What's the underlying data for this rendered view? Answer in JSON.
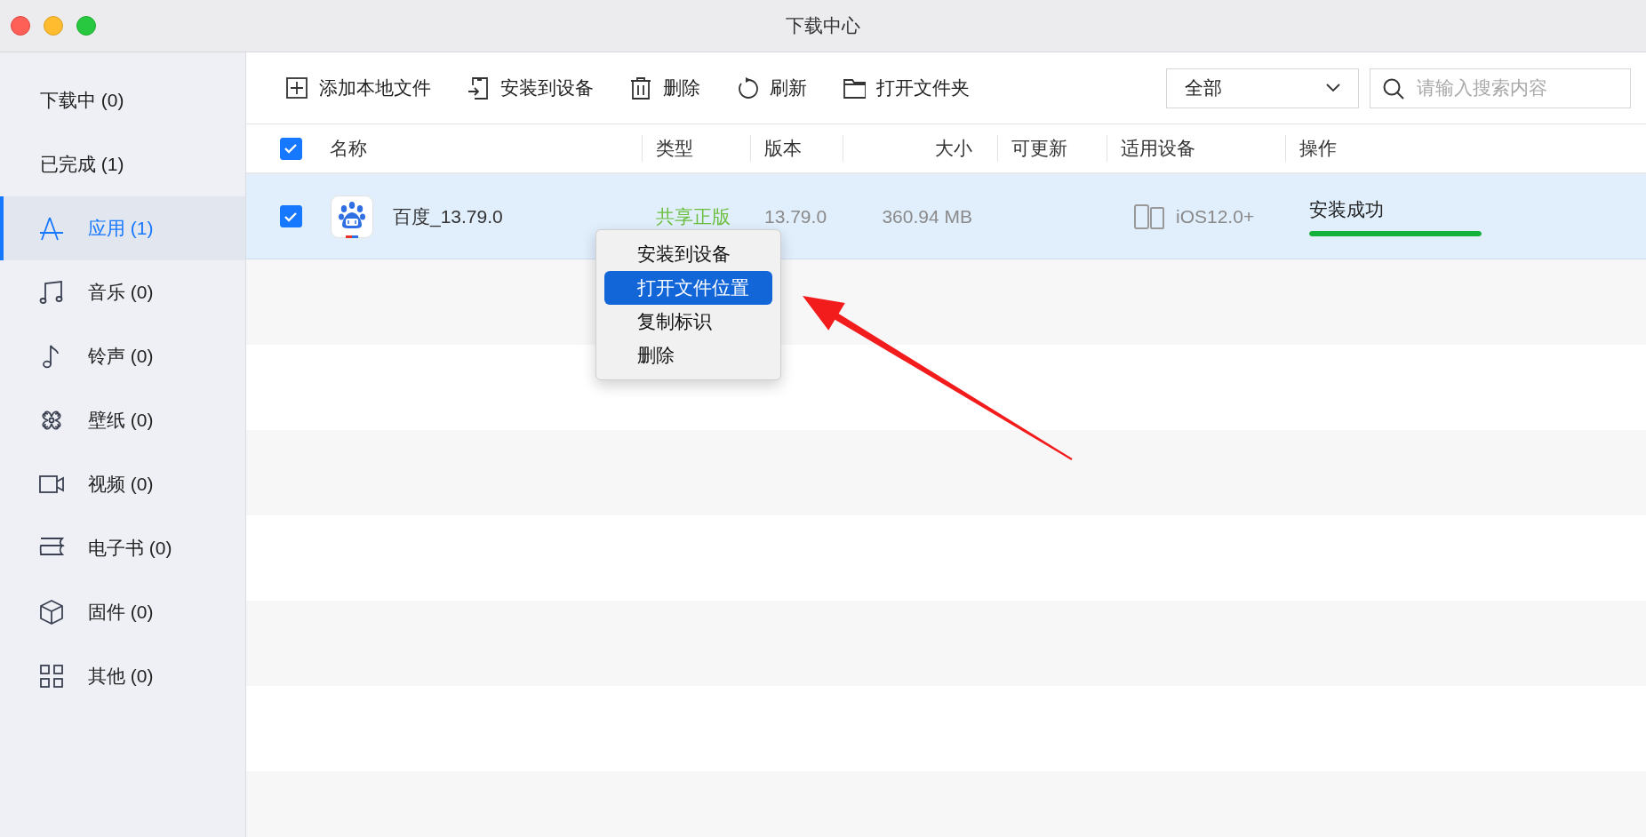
{
  "window": {
    "title": "下载中心"
  },
  "sidebar": {
    "items": [
      {
        "kind": "status",
        "label": "下载中 (0)",
        "selected": false
      },
      {
        "kind": "status",
        "label": "已完成 (1)",
        "selected": false
      },
      {
        "kind": "category",
        "label": "应用 (1)",
        "selected": true
      },
      {
        "kind": "category",
        "label": "音乐 (0)",
        "selected": false
      },
      {
        "kind": "category",
        "label": "铃声 (0)",
        "selected": false
      },
      {
        "kind": "category",
        "label": "壁纸 (0)",
        "selected": false
      },
      {
        "kind": "category",
        "label": "视频 (0)",
        "selected": false
      },
      {
        "kind": "category",
        "label": "电子书 (0)",
        "selected": false
      },
      {
        "kind": "category",
        "label": "固件 (0)",
        "selected": false
      },
      {
        "kind": "category",
        "label": "其他 (0)",
        "selected": false
      }
    ]
  },
  "toolbar": {
    "buttons": [
      "添加本地文件",
      "安装到设备",
      "删除",
      "刷新",
      "打开文件夹"
    ],
    "filter": {
      "value": "全部"
    },
    "search": {
      "placeholder": "请输入搜索内容"
    }
  },
  "table": {
    "select_all": {
      "checked": true
    },
    "columns": [
      "名称",
      "类型",
      "版本",
      "大小",
      "可更新",
      "适用设备",
      "操作"
    ],
    "rows": [
      {
        "selected": true,
        "checked": true,
        "name": "百度_13.79.0",
        "type": "共享正版",
        "version": "13.79.0",
        "size": "360.94 MB",
        "device": "iOS12.0+",
        "action": "安装成功",
        "level": 1
      }
    ]
  },
  "context_menu": {
    "items": [
      {
        "label": "安装到设备",
        "selected": false
      },
      {
        "label": "打开文件位置",
        "selected": true
      },
      {
        "label": "复制标识",
        "selected": false
      },
      {
        "label": "删除",
        "selected": false
      }
    ]
  }
}
